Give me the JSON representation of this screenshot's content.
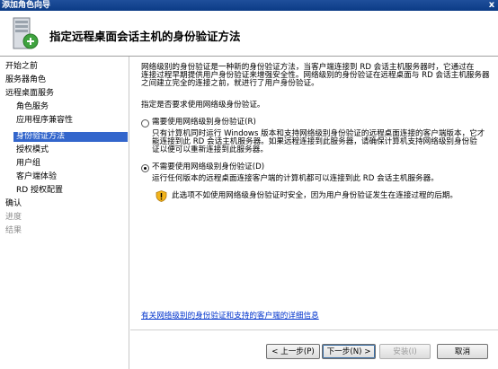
{
  "window": {
    "title": "添加角色向导",
    "close_glyph": "x"
  },
  "header": {
    "title": "指定远程桌面会话主机的身份验证方法",
    "icon": "server-wizard-icon"
  },
  "nav": {
    "items": [
      {
        "label": "开始之前",
        "state": "normal",
        "level": 0
      },
      {
        "label": "服务器角色",
        "state": "normal",
        "level": 0
      },
      {
        "label": "远程桌面服务",
        "state": "normal",
        "level": 0
      },
      {
        "label": "角色服务",
        "state": "normal",
        "level": 1
      },
      {
        "label": "应用程序兼容性",
        "state": "normal",
        "level": 1
      },
      {
        "label": "身份验证方法",
        "state": "selected",
        "level": 1
      },
      {
        "label": "授权模式",
        "state": "normal",
        "level": 1
      },
      {
        "label": "用户组",
        "state": "normal",
        "level": 1
      },
      {
        "label": "客户端体验",
        "state": "normal",
        "level": 1
      },
      {
        "label": "RD 授权配置",
        "state": "normal",
        "level": 1
      },
      {
        "label": "确认",
        "state": "normal",
        "level": 0
      },
      {
        "label": "进度",
        "state": "disabled",
        "level": 0
      },
      {
        "label": "结果",
        "state": "disabled",
        "level": 0
      }
    ]
  },
  "content": {
    "intro_line1": "网络级别的身份验证是一种新的身份验证方法，当客户端连接到 RD 会话主机服务器时，它通过在",
    "intro_line2": "连接过程早期提供用户身份验证来增强安全性。网络级别的身份验证在远程桌面与 RD 会话主机服务器",
    "intro_line3": "之间建立完全的连接之前，就进行了用户身份验证。",
    "prompt": "指定是否要求使用网络级身份验证。",
    "option_require": {
      "label": "需要使用网络级别身份验证(R)",
      "selected": false,
      "desc_line1": "只有计算机同时运行 Windows 版本和支持网络级别身份验证的远程桌面连接的客户端版本，它才",
      "desc_line2": "能连接到此 RD 会话主机服务器。如果远程连接到此服务器，请确保计算机支持网络级别身份验",
      "desc_line3": "证以便可以重新连接到此服务器。"
    },
    "option_no_require": {
      "label": "不需要使用网络级别身份验证(D)",
      "selected": true,
      "desc": "运行任何版本的远程桌面连接客户端的计算机都可以连接到此 RD 会话主机服务器。"
    },
    "warning": {
      "icon": "security-warning-shield-icon",
      "text": "此选项不如使用网络级身份验证时安全，因为用户身份验证发生在连接过程的后期。"
    },
    "help_link": "有关网络级别的身份验证和支持的客户端的详细信息"
  },
  "buttons": {
    "back": "< 上一步(P)",
    "next": "下一步(N) >",
    "install": "安装(I)",
    "cancel": "取消"
  }
}
